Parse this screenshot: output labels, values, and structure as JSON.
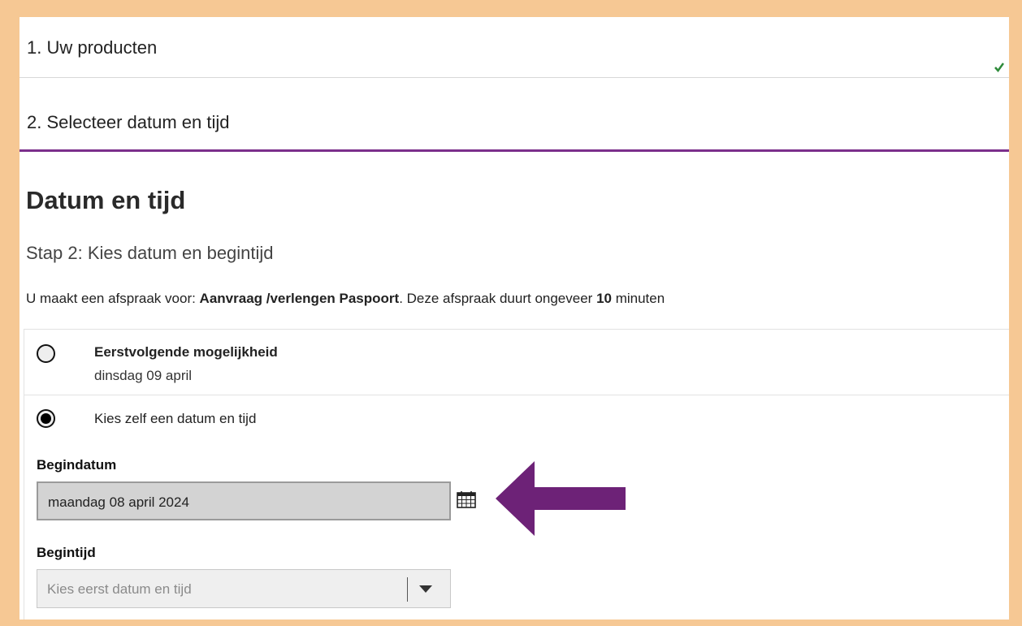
{
  "steps": {
    "step1": "1. Uw producten",
    "step2": "2. Selecteer datum en tijd"
  },
  "page": {
    "title": "Datum en tijd",
    "subtitle": "Stap 2: Kies datum en begintijd",
    "info_prefix": "U maakt een afspraak voor: ",
    "info_product": "Aanvraag /verlengen Paspoort",
    "info_middle": ". Deze afspraak duurt ongeveer ",
    "info_minutes": "10",
    "info_suffix": " minuten"
  },
  "options": {
    "first_available_title": "Eerstvolgende mogelijkheid",
    "first_available_date": "dinsdag 09 april",
    "choose_self_label": "Kies zelf een datum en tijd"
  },
  "form": {
    "begindatum_label": "Begindatum",
    "begindatum_value": "maandag 08 april 2024",
    "begintijd_label": "Begintijd",
    "begintijd_placeholder": "Kies eerst datum en tijd"
  },
  "colors": {
    "accent_purple": "#7b2f8b",
    "frame_orange": "#f6c894",
    "check_green": "#2e8b3a"
  },
  "icons": [
    "check-icon",
    "calendar-icon",
    "arrow-left-icon",
    "chevron-down-icon"
  ]
}
